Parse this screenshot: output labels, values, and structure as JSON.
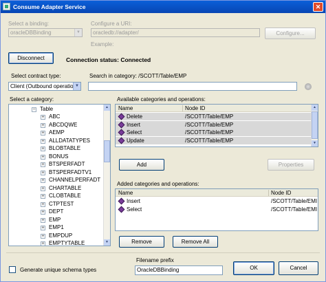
{
  "window": {
    "title": "Consume Adapter Service",
    "close_glyph": "✕"
  },
  "binding": {
    "label": "Select a binding:",
    "value": "oracleDBBinding"
  },
  "uri": {
    "label": "Configure a URI:",
    "value": "oracledb://adapter/",
    "example_label": "Example:"
  },
  "configure_button": "Configure...",
  "disconnect_button": "Disconnect",
  "connection_status": "Connection status: Connected",
  "contract": {
    "label": "Select contract type:",
    "value": "Client (Outbound operation"
  },
  "search": {
    "label": "Search in category: /SCOTT/Table/EMP",
    "value": ""
  },
  "category": {
    "label": "Select a category:",
    "root": {
      "expander": "−",
      "label": "Table"
    },
    "items": [
      "ABC",
      "ABCDQWE",
      "AEMP",
      "ALLDATATYPES",
      "BLOBTABLE",
      "BONUS",
      "BTSPERFADT",
      "BTSPERFADTV1",
      "CHANNELPERFADT",
      "CHARTABLE",
      "CLOBTABLE",
      "CTPTEST",
      "DEPT",
      "EMP",
      "EMP1",
      "EMPDUP",
      "EMPTYTABLE"
    ],
    "expander": "+"
  },
  "available": {
    "label": "Available categories and operations:",
    "columns": [
      "Name",
      "Node ID"
    ],
    "rows": [
      {
        "name": "Delete",
        "node_id": "/SCOTT/Table/EMP"
      },
      {
        "name": "Insert",
        "node_id": "/SCOTT/Table/EMP"
      },
      {
        "name": "Select",
        "node_id": "/SCOTT/Table/EMP"
      },
      {
        "name": "Update",
        "node_id": "/SCOTT/Table/EMP"
      }
    ]
  },
  "add_button": "Add",
  "properties_button": "Properties",
  "added": {
    "label": "Added categories and operations:",
    "columns": [
      "Name",
      "Node ID"
    ],
    "rows": [
      {
        "name": "Insert",
        "node_id": "/SCOTT/Table/EMI"
      },
      {
        "name": "Select",
        "node_id": "/SCOTT/Table/EMI"
      }
    ]
  },
  "remove_button": "Remove",
  "remove_all_button": "Remove All",
  "generate_unique": {
    "label": "Generate unique schema types",
    "checked": false
  },
  "filename": {
    "label": "Filename prefix",
    "value": "OracleDBBinding"
  },
  "ok_button": "OK",
  "cancel_button": "Cancel",
  "icons": {
    "operation": "operation-diamond-icon",
    "app": "app-icon"
  },
  "colors": {
    "titlebar": "#0a5fd8",
    "dialog_bg": "#ece9d8",
    "border": "#7f9db9"
  }
}
